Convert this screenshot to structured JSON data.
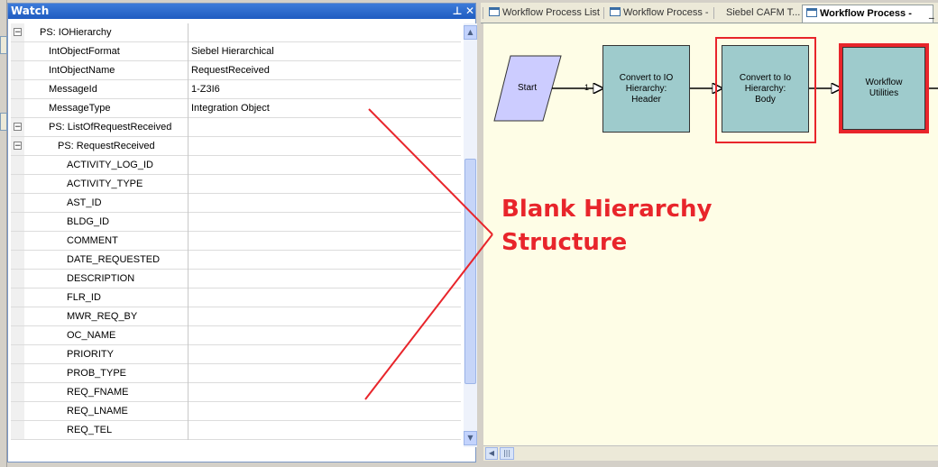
{
  "watch": {
    "title": "Watch",
    "pin_glyph": "⊥",
    "close_glyph": "✕",
    "rows": [
      {
        "name": "PS: IOHierarchy",
        "value": "",
        "indent": 1,
        "expander": "−"
      },
      {
        "name": "IntObjectFormat",
        "value": "Siebel Hierarchical",
        "indent": 2,
        "expander": ""
      },
      {
        "name": "IntObjectName",
        "value": "RequestReceived",
        "indent": 2,
        "expander": ""
      },
      {
        "name": "MessageId",
        "value": "1-Z3I6",
        "indent": 2,
        "expander": ""
      },
      {
        "name": "MessageType",
        "value": "Integration Object",
        "indent": 2,
        "expander": ""
      },
      {
        "name": "PS: ListOfRequestReceived",
        "value": "",
        "indent": 2,
        "expander": "−"
      },
      {
        "name": "PS: RequestReceived",
        "value": "",
        "indent": 3,
        "expander": "−"
      },
      {
        "name": "ACTIVITY_LOG_ID",
        "value": "",
        "indent": 4,
        "expander": ""
      },
      {
        "name": "ACTIVITY_TYPE",
        "value": "",
        "indent": 4,
        "expander": ""
      },
      {
        "name": "AST_ID",
        "value": "",
        "indent": 4,
        "expander": ""
      },
      {
        "name": "BLDG_ID",
        "value": "",
        "indent": 4,
        "expander": ""
      },
      {
        "name": "COMMENT",
        "value": "",
        "indent": 4,
        "expander": ""
      },
      {
        "name": "DATE_REQUESTED",
        "value": "",
        "indent": 4,
        "expander": ""
      },
      {
        "name": "DESCRIPTION",
        "value": "",
        "indent": 4,
        "expander": ""
      },
      {
        "name": "FLR_ID",
        "value": "",
        "indent": 4,
        "expander": ""
      },
      {
        "name": "MWR_REQ_BY",
        "value": "",
        "indent": 4,
        "expander": ""
      },
      {
        "name": "OC_NAME",
        "value": "",
        "indent": 4,
        "expander": ""
      },
      {
        "name": "PRIORITY",
        "value": "",
        "indent": 4,
        "expander": ""
      },
      {
        "name": "PROB_TYPE",
        "value": "",
        "indent": 4,
        "expander": ""
      },
      {
        "name": "REQ_FNAME",
        "value": "",
        "indent": 4,
        "expander": ""
      },
      {
        "name": "REQ_LNAME",
        "value": "",
        "indent": 4,
        "expander": ""
      },
      {
        "name": "REQ_TEL",
        "value": "",
        "indent": 4,
        "expander": ""
      }
    ]
  },
  "tabs": [
    {
      "label": "Workflow Process List",
      "icon": true,
      "active": false
    },
    {
      "label": "Workflow Process -",
      "icon": true,
      "active": false
    },
    {
      "label": "Siebel CAFM T...",
      "icon": false,
      "active": false
    },
    {
      "label": "Workflow Process -",
      "icon": true,
      "active": true
    }
  ],
  "workflow": {
    "start_label": "Start",
    "connector_label": "1",
    "steps": [
      {
        "label": "Convert to IO Hierarchy: Header",
        "highlighted": false
      },
      {
        "label": "Convert to Io Hierarchy: Body",
        "highlighted": true
      },
      {
        "label": "Workflow Utilities",
        "highlighted": true
      }
    ]
  },
  "annotation": {
    "line1": "Blank Hierarchy",
    "line2": "Structure",
    "color": "#e8252b"
  },
  "colors": {
    "title_bar": "#2a66cc",
    "step_fill": "#9ecbcc",
    "start_fill": "#ccccff",
    "canvas_bg": "#fefde6",
    "highlight": "#e8252b"
  }
}
